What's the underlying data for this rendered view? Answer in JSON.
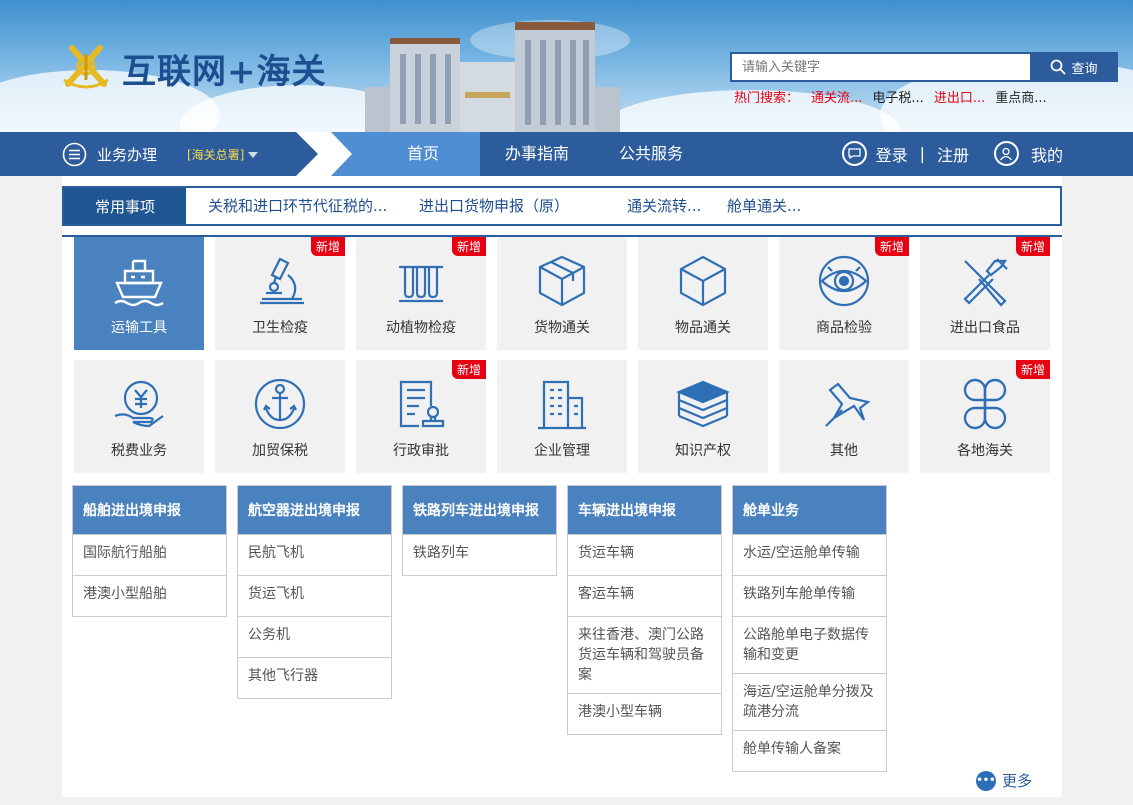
{
  "header": {
    "site_title": "互联网+海关",
    "search_placeholder": "请输入关键字",
    "search_button": "查询",
    "hot_label": "热门搜索：",
    "hot_terms": [
      "通关流...",
      "电子税...",
      "进出口...",
      "重点商..."
    ]
  },
  "nav": {
    "business": "业务办理",
    "org": "[海关总署]",
    "tabs": [
      "首页",
      "办事指南",
      "公共服务"
    ],
    "login": "登录",
    "separator": "|",
    "register": "注册",
    "mine": "我的"
  },
  "common": {
    "title": "常用事项",
    "items": [
      "关税和进口环节代征税的...",
      "进出口货物申报（原）",
      "通关流转...",
      "舱单通关..."
    ]
  },
  "badge_text": "新增",
  "tiles": [
    {
      "label": "运输工具",
      "icon": "ship-icon",
      "new": false,
      "active": true
    },
    {
      "label": "卫生检疫",
      "icon": "microscope-icon",
      "new": true
    },
    {
      "label": "动植物检疫",
      "icon": "test-tubes-icon",
      "new": true
    },
    {
      "label": "货物通关",
      "icon": "box-icon",
      "new": false
    },
    {
      "label": "物品通关",
      "icon": "cube-icon",
      "new": false
    },
    {
      "label": "商品检验",
      "icon": "eye-icon",
      "new": true
    },
    {
      "label": "进出口食品",
      "icon": "fork-knife-icon",
      "new": true
    },
    {
      "label": "税费业务",
      "icon": "yuan-hand-icon",
      "new": false
    },
    {
      "label": "加贸保税",
      "icon": "anchor-icon",
      "new": false
    },
    {
      "label": "行政审批",
      "icon": "document-stamp-icon",
      "new": true
    },
    {
      "label": "企业管理",
      "icon": "building-icon",
      "new": false
    },
    {
      "label": "知识产权",
      "icon": "books-icon",
      "new": false
    },
    {
      "label": "其他",
      "icon": "pin-icon",
      "new": false
    },
    {
      "label": "各地海关",
      "icon": "clover-icon",
      "new": true
    }
  ],
  "columns": [
    {
      "title": "船舶进出境申报",
      "items": [
        "国际航行船舶",
        "港澳小型船舶"
      ]
    },
    {
      "title": "航空器进出境申报",
      "items": [
        "民航飞机",
        "货运飞机",
        "公务机",
        "其他飞行器"
      ]
    },
    {
      "title": "铁路列车进出境申报",
      "items": [
        "铁路列车"
      ]
    },
    {
      "title": "车辆进出境申报",
      "items": [
        "货运车辆",
        "客运车辆",
        "来往香港、澳门公路货运车辆和驾驶员备案",
        "港澳小型车辆"
      ]
    },
    {
      "title": "舱单业务",
      "items": [
        "水运/空运舱单传输",
        "铁路列车舱单传输",
        "公路舱单电子数据传输和变更",
        "海运/空运舱单分拨及疏港分流",
        "舱单传输人备案"
      ]
    }
  ],
  "more": "更多",
  "colors": {
    "nav": "#2c5c9c",
    "nav_active": "#4f8ed3",
    "tile_active": "#4a82c0",
    "badge": "#e60012",
    "icon": "#2f6fb6"
  }
}
